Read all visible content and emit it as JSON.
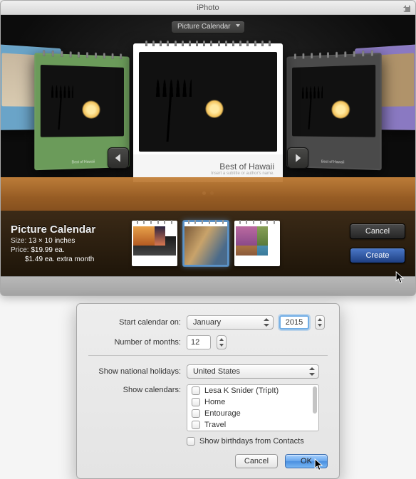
{
  "window": {
    "title": "iPhoto",
    "type_picker": "Picture Calendar"
  },
  "carousel": {
    "center_title": "Best of Hawaii",
    "center_subtitle": "Insert a subtitle or author's name.",
    "side_caption": "Best of Hawaii"
  },
  "product": {
    "title": "Picture Calendar",
    "size_label": "Size:",
    "size_value": "13 × 10 inches",
    "price_label": "Price:",
    "price_value": "$19.99 ea.",
    "extra": "$1.49 ea. extra month"
  },
  "buttons": {
    "cancel": "Cancel",
    "create": "Create"
  },
  "dialog": {
    "start_label": "Start calendar on:",
    "start_month": "January",
    "start_year": "2015",
    "months_label": "Number of months:",
    "months_value": "12",
    "holidays_label": "Show national holidays:",
    "holidays_value": "United States",
    "calendars_label": "Show calendars:",
    "cal_items": {
      "0": "Lesa K Snider (TripIt)",
      "1": "Home",
      "2": "Entourage",
      "3": "Travel"
    },
    "birthdays_label": "Show birthdays from Contacts",
    "cancel": "Cancel",
    "ok": "OK"
  }
}
